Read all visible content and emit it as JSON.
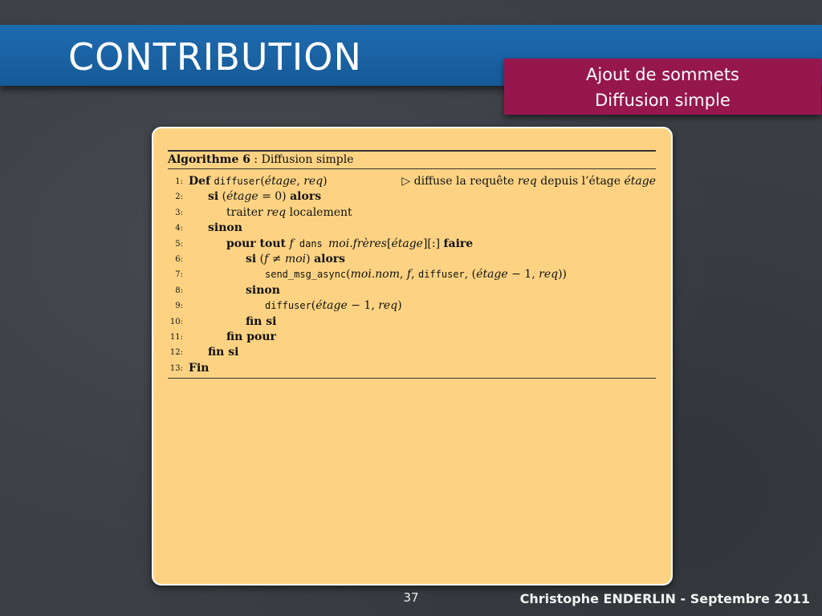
{
  "slide": {
    "title": "CONTRIBUTION",
    "subtitle_line1": "Ajout de sommets",
    "subtitle_line2": "Diffusion simple",
    "page_number": "37",
    "footer": "Christophe ENDERLIN  - Septembre 2011"
  },
  "algorithm": {
    "header_label": "Algorithme 6",
    "header_sep": " : ",
    "header_title": "Diffusion simple",
    "lines": [
      {
        "n": "1:",
        "kw1": "Def",
        "fn": "diffuser",
        "args_open": "(",
        "a1": "étage",
        "sep1": ", ",
        "a2": "req",
        "args_close": ")",
        "comment_sym": "▷",
        "comment_text": " diffuse la requête ",
        "comment_it": "req",
        "comment_text2": " depuis l’étage ",
        "comment_it2": "étage"
      },
      {
        "n": "2:",
        "kw1": "si",
        "t1": " (",
        "it1": "étage",
        "t2": " = 0) ",
        "kw2": "alors"
      },
      {
        "n": "3:",
        "t1": "traiter ",
        "it1": "req",
        "t2": " localement"
      },
      {
        "n": "4:",
        "kw1": "sinon"
      },
      {
        "n": "5:",
        "kw1": "pour tout",
        "t1": " ",
        "it1": "f",
        "tt1": " dans ",
        "it2": "moi.frères",
        "t2": "[",
        "it3": "étage",
        "t3": "][:] ",
        "kw2": "faire"
      },
      {
        "n": "6:",
        "kw1": "si",
        "t1": " (",
        "it1": "f",
        "t2": " ≠ ",
        "it2": "moi",
        "t3": ") ",
        "kw2": "alors"
      },
      {
        "n": "7:",
        "tt1": "send_msg_async",
        "t1": "(",
        "it1": "moi.nom",
        "t2": ", ",
        "it2": "f",
        "t3": ", ",
        "tt2": "diffuser",
        "t4": ", (",
        "it3": "étage",
        "t5": " − 1, ",
        "it4": "req",
        "t6": "))"
      },
      {
        "n": "8:",
        "kw1": "sinon"
      },
      {
        "n": "9:",
        "tt1": "diffuser",
        "t1": "(",
        "it1": "étage",
        "t2": " − 1, ",
        "it2": "req",
        "t3": ")"
      },
      {
        "n": "10:",
        "kw1": "fin si"
      },
      {
        "n": "11:",
        "kw1": "fin pour"
      },
      {
        "n": "12:",
        "kw1": "fin si"
      },
      {
        "n": "13:",
        "kw1": "Fin"
      }
    ]
  }
}
